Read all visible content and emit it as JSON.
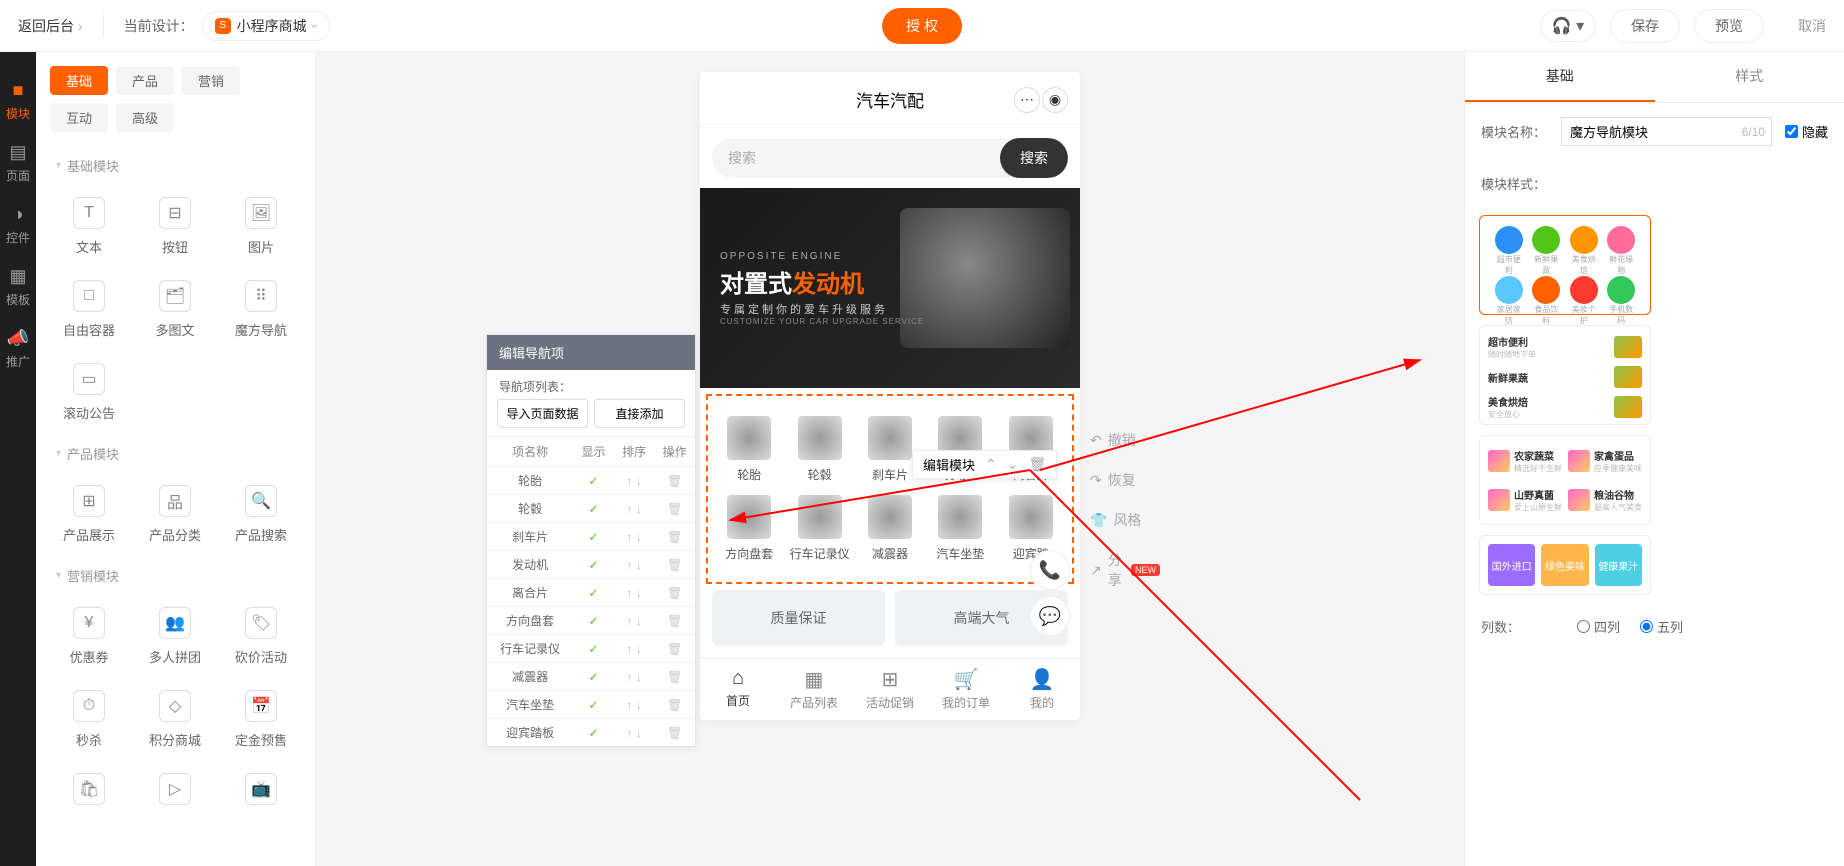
{
  "topbar": {
    "back": "返回后台",
    "design_label": "当前设计：",
    "design_select": "小程序商城",
    "authorize": "授 权",
    "save": "保存",
    "preview": "预览",
    "cancel": "取消"
  },
  "rail": [
    {
      "icon": "■",
      "label": "模块",
      "active": true
    },
    {
      "icon": "▤",
      "label": "页面"
    },
    {
      "icon": "◑",
      "label": "控件"
    },
    {
      "icon": "▦",
      "label": "模板"
    },
    {
      "icon": "📣",
      "label": "推广"
    }
  ],
  "cat_tabs": [
    {
      "label": "基础",
      "active": true
    },
    {
      "label": "产品"
    },
    {
      "label": "营销"
    },
    {
      "label": "互动"
    },
    {
      "label": "高级"
    }
  ],
  "groups": [
    {
      "title": "基础模块",
      "items": [
        {
          "icon": "T",
          "label": "文本"
        },
        {
          "icon": "⊟",
          "label": "按钮"
        },
        {
          "icon": "🖼",
          "label": "图片"
        },
        {
          "icon": "□",
          "label": "自由容器"
        },
        {
          "icon": "🗂",
          "label": "多图文"
        },
        {
          "icon": "⠿",
          "label": "魔方导航"
        },
        {
          "icon": "▭",
          "label": "滚动公告"
        }
      ]
    },
    {
      "title": "产品模块",
      "items": [
        {
          "icon": "⊞",
          "label": "产品展示"
        },
        {
          "icon": "品",
          "label": "产品分类"
        },
        {
          "icon": "🔍",
          "label": "产品搜索"
        }
      ]
    },
    {
      "title": "营销模块",
      "items": [
        {
          "icon": "¥",
          "label": "优惠券"
        },
        {
          "icon": "👥",
          "label": "多人拼团"
        },
        {
          "icon": "🏷",
          "label": "砍价活动"
        },
        {
          "icon": "⏱",
          "label": "秒杀"
        },
        {
          "icon": "◇",
          "label": "积分商城"
        },
        {
          "icon": "📅",
          "label": "定金预售"
        }
      ]
    }
  ],
  "more_row": [
    {
      "icon": "🛍"
    },
    {
      "icon": "▷"
    },
    {
      "icon": "📺"
    }
  ],
  "phone": {
    "title": "汽车汽配",
    "search_placeholder": "搜索",
    "search_btn": "搜索",
    "banner": {
      "sub": "OPPOSITE ENGINE",
      "main1": "对置式",
      "main2": "发动机",
      "desc": "专属定制你的爱车升级服务",
      "desc2": "CUSTOMIZE YOUR CAR UPGRADE SERVICE"
    },
    "nav_items": [
      "轮胎",
      "轮毂",
      "刹车片",
      "发动机",
      "离合片",
      "方向盘套",
      "行车记录仪",
      "减震器",
      "汽车坐垫",
      "迎宾踏"
    ],
    "promo": [
      "质量保证",
      "高端大气"
    ],
    "tabs": [
      {
        "icon": "⌂",
        "label": "首页",
        "active": true
      },
      {
        "icon": "▦",
        "label": "产品列表"
      },
      {
        "icon": "⊞",
        "label": "活动促销"
      },
      {
        "icon": "🛒",
        "label": "我的订单"
      },
      {
        "icon": "👤",
        "label": "我的"
      }
    ],
    "edit_label": "编辑模块"
  },
  "side_actions": [
    {
      "icon": "↶",
      "label": "撤销"
    },
    {
      "icon": "↷",
      "label": "恢复"
    },
    {
      "icon": "👕",
      "label": "风格"
    },
    {
      "icon": "↗",
      "label": "分享",
      "badge": "NEW"
    }
  ],
  "edit_panel": {
    "header": "编辑导航项",
    "sub": "导航项列表：",
    "import_btn": "导入页面数据",
    "add_btn": "直接添加",
    "cols": [
      "项名称",
      "显示",
      "排序",
      "操作"
    ],
    "rows": [
      {
        "name": "轮胎"
      },
      {
        "name": "轮毂"
      },
      {
        "name": "刹车片"
      },
      {
        "name": "发动机"
      },
      {
        "name": "离合片"
      },
      {
        "name": "方向盘套"
      },
      {
        "name": "行车记录仪"
      },
      {
        "name": "减震器"
      },
      {
        "name": "汽车坐垫"
      },
      {
        "name": "迎宾踏板"
      }
    ]
  },
  "right": {
    "tabs": [
      "基础",
      "样式"
    ],
    "name_label": "模块名称：",
    "name_value": "魔方导航模块",
    "name_counter": "6/10",
    "hide_label": "隐藏",
    "style_label": "模块样式：",
    "cols_label": "列数：",
    "cols_options": [
      "四列",
      "五列"
    ],
    "style1_labels": [
      "超市便利",
      "新鲜果蔬",
      "美食烘焙",
      "鲜花缘物"
    ],
    "style1_icons": [
      "超市便利",
      "新鲜果蔬",
      "美食烘焙",
      "鲜花缘物",
      "家居家纺",
      "食品饮料",
      "美妆个护",
      "手机数码"
    ],
    "style3_items": [
      {
        "t": "农家蔬菜",
        "s": "精选好干生鲜"
      },
      {
        "t": "家禽蛋品",
        "s": "应季健康美味"
      },
      {
        "t": "山野真菌",
        "s": "爱上山原生鲜"
      },
      {
        "t": "粮油谷物",
        "s": "最高人气美食"
      }
    ],
    "style4_tags": [
      "国外进口",
      "绿色美味",
      "健康果汁"
    ]
  }
}
